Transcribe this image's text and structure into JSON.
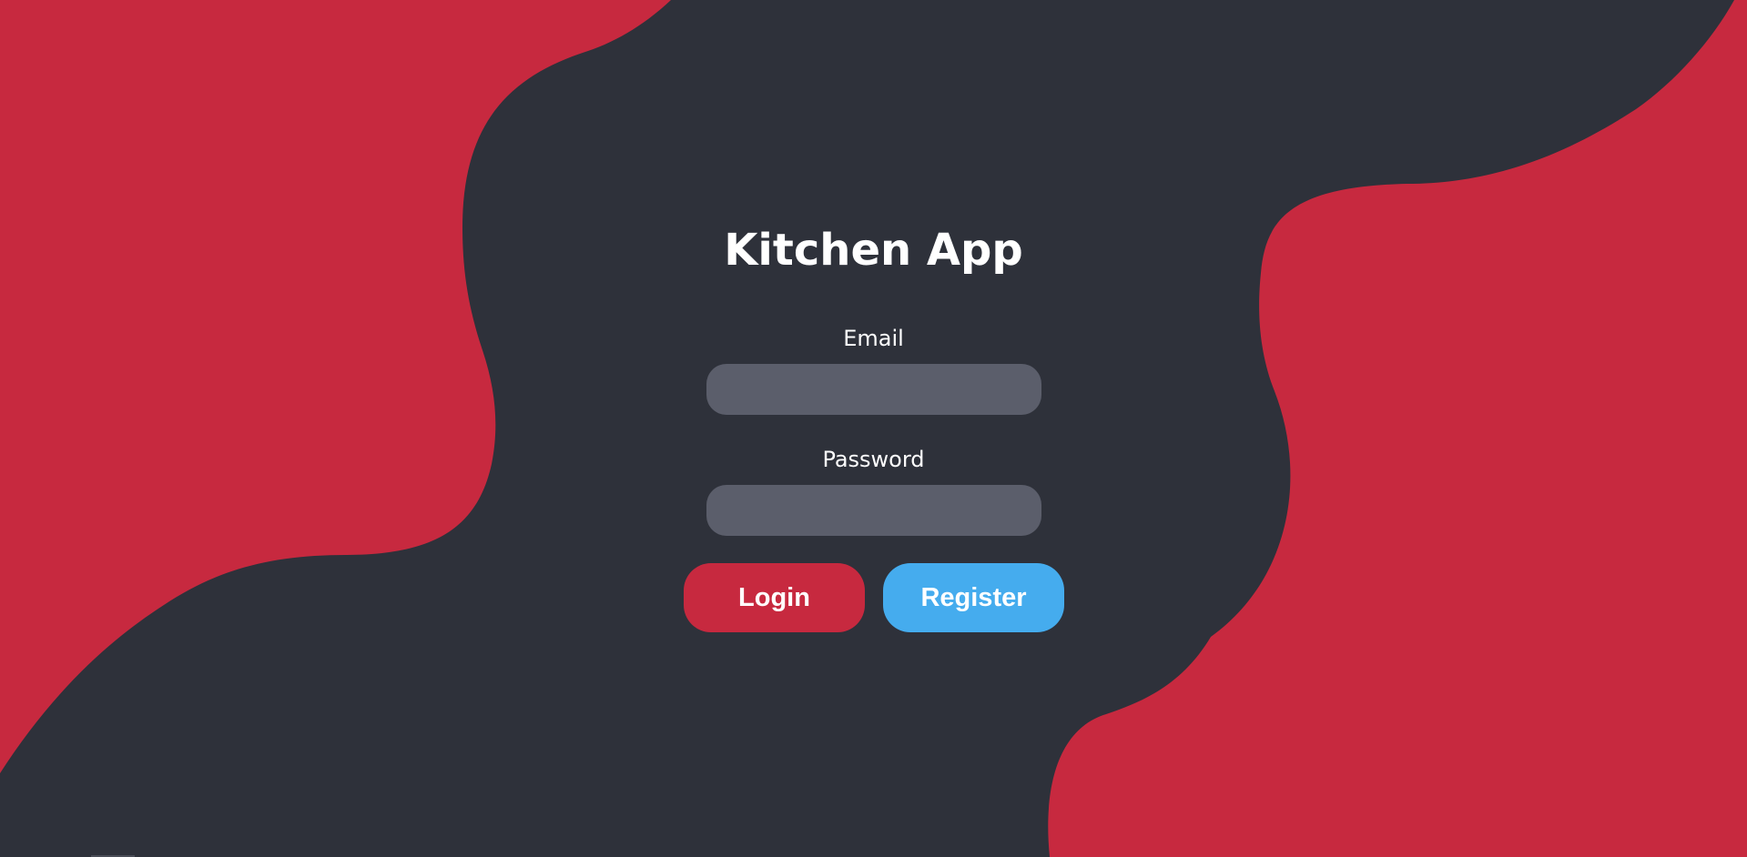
{
  "app": {
    "title": "Kitchen App"
  },
  "form": {
    "email_label": "Email",
    "email_value": "",
    "password_label": "Password",
    "password_value": ""
  },
  "buttons": {
    "login_label": "Login",
    "register_label": "Register"
  },
  "colors": {
    "background": "#2e313a",
    "accent_red": "#c7293f",
    "accent_blue": "#45acee",
    "input_fill": "#5b5e6b",
    "text": "#ffffff"
  }
}
